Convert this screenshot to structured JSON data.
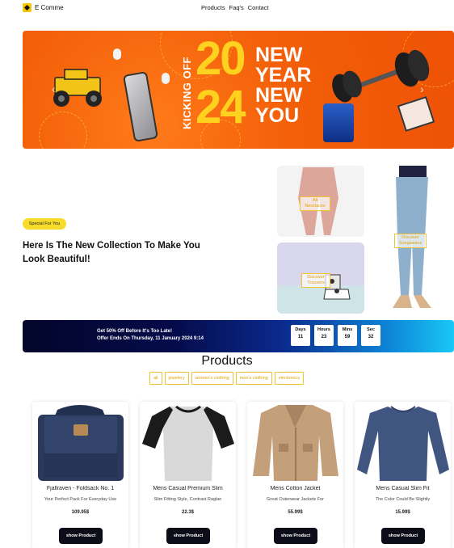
{
  "nav": {
    "brand": "E Comme",
    "links": [
      "Products",
      "Faq's",
      "Contact"
    ]
  },
  "hero": {
    "kicking_text": "KICKING OFF",
    "year_top": "20",
    "year_bottom": "24",
    "tagline_lines": [
      "NEW",
      "YEAR",
      "NEW",
      "YOU"
    ],
    "prev_arrow": "‹",
    "next_arrow": "›"
  },
  "collection": {
    "badge": "Special For You",
    "title": "Here Is The New Collection To Make You Look Beautiful!",
    "tiles": [
      {
        "label": "All Necklaces"
      },
      {
        "label": "Discover Trousers"
      },
      {
        "label": "Discover Sunglasses"
      }
    ]
  },
  "countdown": {
    "line1": "Get 50% Off Before It's Too Late!",
    "line2": "Offer Ends On Thursday, 11 January 2024 9:14",
    "units": [
      {
        "label": "Days",
        "value": "11"
      },
      {
        "label": "Hours",
        "value": "23"
      },
      {
        "label": "Mins",
        "value": "59"
      },
      {
        "label": "Sec",
        "value": "32"
      }
    ]
  },
  "products": {
    "heading": "Products",
    "filters": [
      "all",
      "jewelery",
      "women's clothing",
      "men's clothing",
      "electronics"
    ],
    "items": [
      {
        "title": "Fjallraven - Foldsack No. 1",
        "desc": "Your Perfect Pack For Everyday Use",
        "price": "109.95$",
        "button": "show Product"
      },
      {
        "title": "Mens Casual Premium Slim",
        "desc": "Slim Fitting Style, Contrast Raglan",
        "price": "22.3$",
        "button": "show Product"
      },
      {
        "title": "Mens Cotton Jacket",
        "desc": "Great Outerwear Jackets For",
        "price": "55.99$",
        "button": "show Product"
      },
      {
        "title": "Mens Casual Slim Fit",
        "desc": "The Color Could Be Slightly",
        "price": "15.99$",
        "button": "show Product"
      }
    ]
  },
  "colors": {
    "accent": "#f6dc28",
    "filter_border": "#f1c232",
    "button_bg": "#0d0d1a",
    "hero_bg": "#f35f08"
  }
}
